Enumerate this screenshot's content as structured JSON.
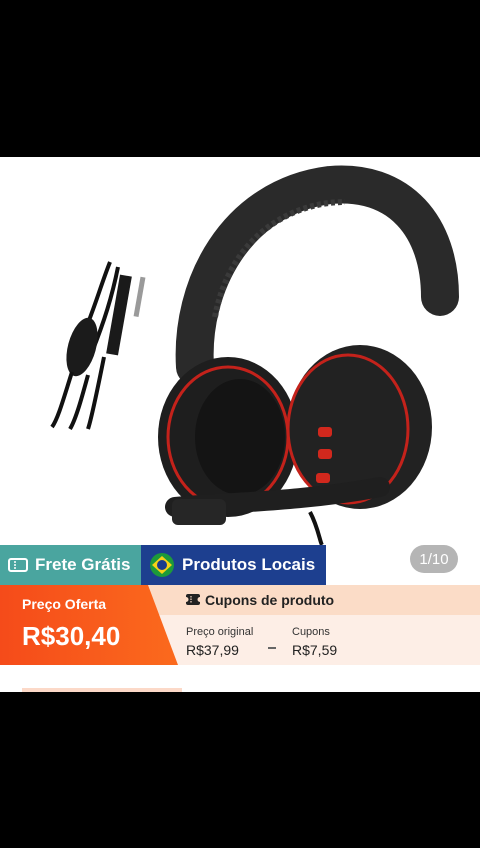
{
  "gallery": {
    "image_alt": "Headset with red accents and 3.5mm cable",
    "counter": "1/10",
    "badges": {
      "free_shipping": "Frete Grátis",
      "local_products": "Produtos Locais"
    }
  },
  "price": {
    "offer_label": "Preço Oferta",
    "offer_price": "R$30,40",
    "coupon_title": "Cupons de produto",
    "original_label": "Preço original",
    "original_price": "R$37,99",
    "coupons_label": "Cupons",
    "coupons_value": "R$7,59"
  },
  "colors": {
    "offer": "#f54b1a",
    "free_shipping": "#4aa59f",
    "local_products": "#1d3f8f",
    "coupon_bg": "#fdeee6"
  }
}
